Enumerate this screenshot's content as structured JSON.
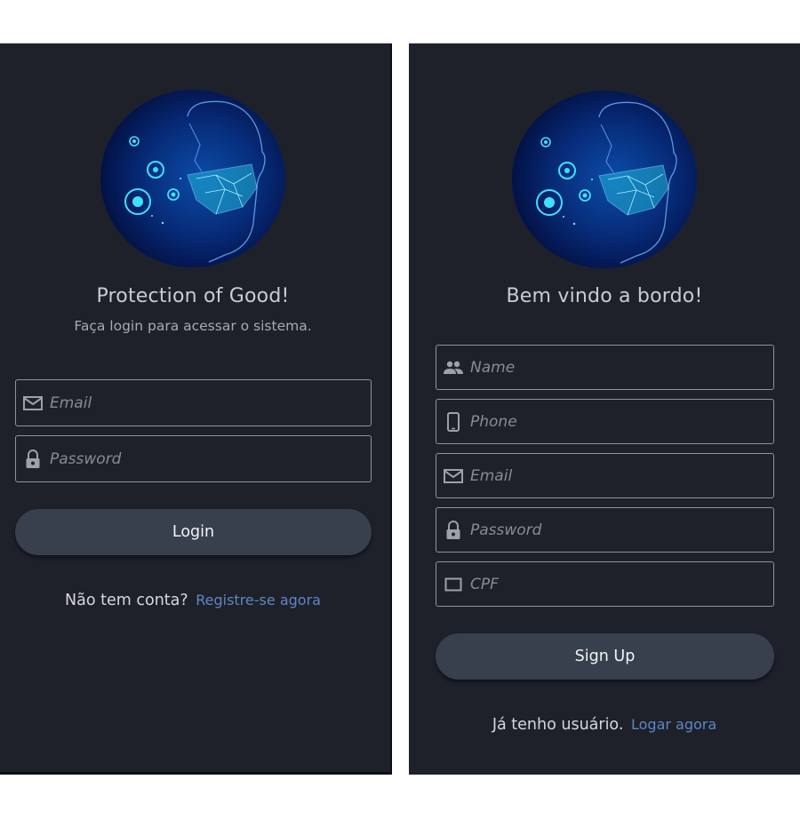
{
  "login": {
    "title": "Protection of Good!",
    "subtitle": "Faça login para acessar o sistema.",
    "fields": {
      "email_placeholder": "Email",
      "password_placeholder": "Password"
    },
    "button_label": "Login",
    "footer_text": "Não tem conta?",
    "footer_link": "Registre-se agora",
    "icons": [
      "mail-icon",
      "lock-icon"
    ]
  },
  "signup": {
    "title": "Bem vindo a bordo!",
    "fields": {
      "name_placeholder": "Name",
      "phone_placeholder": "Phone",
      "email_placeholder": "Email",
      "password_placeholder": "Password",
      "cpf_placeholder": "CPF"
    },
    "button_label": "Sign Up",
    "footer_text": "Já tenho usuário.",
    "footer_link": "Logar agora",
    "icons": [
      "people-icon",
      "phone-icon",
      "mail-icon",
      "lock-icon",
      "card-icon"
    ]
  },
  "colors": {
    "panel_bg": "#1e212a",
    "button_bg": "#383f4d",
    "link": "#5f86c4",
    "border": "#8f939c",
    "accent_cyan": "#3fe0ff"
  }
}
